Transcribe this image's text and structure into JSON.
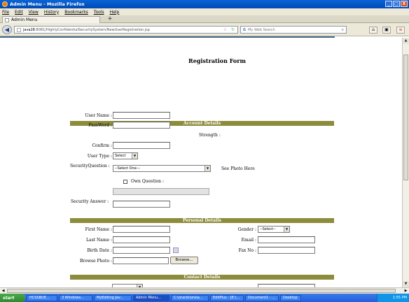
{
  "window": {
    "title": "Admin Menu - Mozilla Firefox",
    "minimize": "_",
    "maximize": "□",
    "close": "X"
  },
  "menubar": {
    "items": [
      "File",
      "Edit",
      "View",
      "History",
      "Bookmarks",
      "Tools",
      "Help"
    ]
  },
  "tabs": {
    "active_label": "Admin Menu",
    "new_tab": "+"
  },
  "nav": {
    "back": "◀",
    "url_host": "java28",
    "url_path": ":8081/HighlyConfidentialSecuritySystem/NewUserRegistration.jsp",
    "search_engine": "G",
    "search_placeholder": "My Web Search",
    "home": "⌂",
    "bookmark_star": "☆",
    "reload": "↻",
    "search_glass": "⌕",
    "extension_icon": "▣",
    "menu_icon": "≡"
  },
  "form": {
    "title": "Registration Form",
    "account": {
      "heading": "Account Details",
      "user_name_label": "User Name :",
      "password_label": "PassWord :",
      "strength_label": "Strength :",
      "confirm_label": "Confirm :",
      "user_type_label": "User Type :",
      "user_type_value": "Select",
      "security_question_label": "SecurityQuestion :",
      "security_question_value": "--Select One---",
      "see_photo": "See Photo Here",
      "own_question_label": "Own Question :",
      "security_answer_label": "Security Answer :"
    },
    "personal": {
      "heading": "Personal Details",
      "first_name_label": "First Name :",
      "last_name_label": "Last Name :",
      "birth_date_label": "Birth Date :",
      "browse_photo_label": "Browse Photo :",
      "browse_button": "Browse...",
      "gender_label": "Gender :",
      "gender_value": "--Select--",
      "email_label": "Email :",
      "fax_label": "Fax No :"
    },
    "contact": {
      "heading": "Contact Details"
    }
  },
  "taskbar": {
    "start": "start",
    "items": [
      "HCSSBUE...",
      "3 Windows...",
      "MyEditing Jav...",
      "Admin Menu...",
      "C:\\oracle\\ora\\a...",
      "EditPlus - [E:\\...",
      "Document1 - ...",
      "Desktop"
    ],
    "clock": "1:55 PM"
  },
  "colors": {
    "section_bar": "#8c8c3c",
    "titlebar": "#0a64d6",
    "taskbar": "#245edb"
  }
}
